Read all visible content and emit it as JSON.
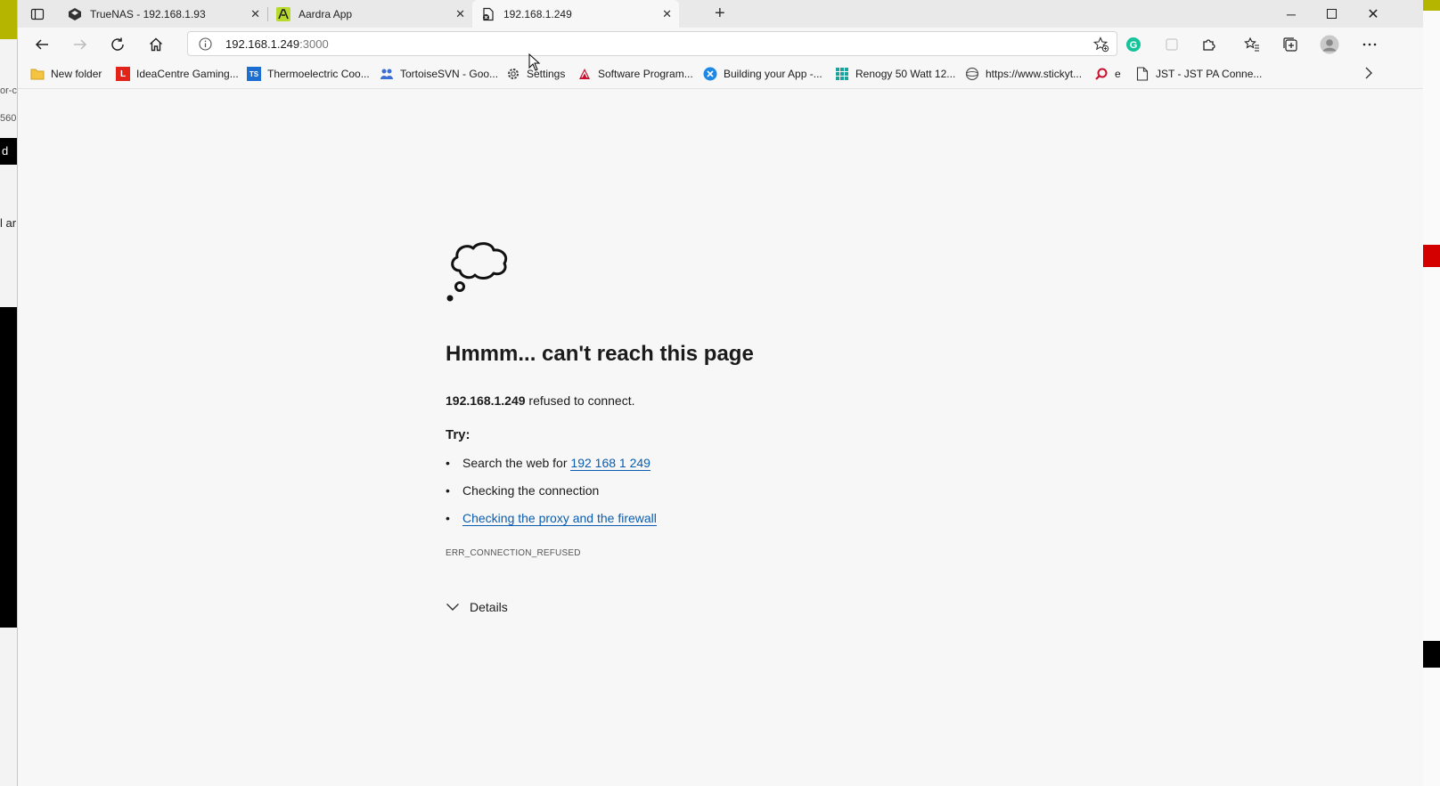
{
  "tabs": [
    {
      "title": "TrueNAS - 192.168.1.93",
      "icon": "truenas-icon",
      "active": false
    },
    {
      "title": "Aardra App",
      "icon": "aardra-icon",
      "active": false
    },
    {
      "title": "192.168.1.249",
      "icon": "page-error-icon",
      "active": true
    }
  ],
  "address": {
    "host": "192.168.1.249",
    "port": ":3000"
  },
  "bookmarks": [
    {
      "label": "New folder",
      "icon": "folder-icon"
    },
    {
      "label": "IdeaCentre Gaming...",
      "icon": "lenovo-icon"
    },
    {
      "label": "Thermoelectric Coo...",
      "icon": "ts-icon"
    },
    {
      "label": "TortoiseSVN - Goo...",
      "icon": "people-icon"
    },
    {
      "label": "Settings",
      "icon": "gear-icon"
    },
    {
      "label": "Software Program...",
      "icon": "microchip-icon"
    },
    {
      "label": "Building your App -...",
      "icon": "app-icon"
    },
    {
      "label": "Renogy 50 Watt 12...",
      "icon": "grid-icon"
    },
    {
      "label": "https://www.stickyt...",
      "icon": "globe-icon"
    },
    {
      "label": "e",
      "icon": "search-icon"
    },
    {
      "label": "JST - JST PA Conne...",
      "icon": "doc-icon"
    }
  ],
  "error": {
    "title": "Hmmm... can't reach this page",
    "host": "192.168.1.249",
    "refused_text": " refused to connect.",
    "try_label": "Try:",
    "suggestion_search_prefix": "Search the web for ",
    "suggestion_search_link": "192 168 1 249",
    "suggestion_connection": "Checking the connection",
    "suggestion_proxy": "Checking the proxy and the firewall",
    "code": "ERR_CONNECTION_REFUSED",
    "details_label": "Details"
  },
  "leftstrip": {
    "text1": "or-c",
    "text2": "560",
    "text3": "d",
    "text4": "l ar"
  }
}
